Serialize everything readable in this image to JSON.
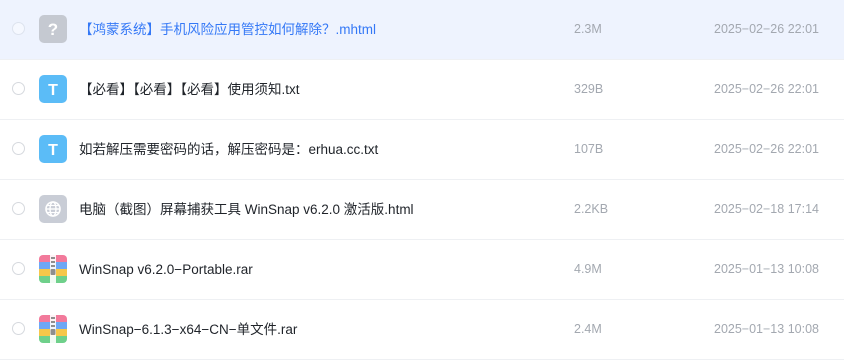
{
  "colors": {
    "selected_row_bg": "#eef3fe",
    "selected_name": "#3478f6",
    "text": "#1f2329",
    "meta_text": "#a3a8b0",
    "txt_icon": "#5bbcf7",
    "unknown_icon": "#c5c9d1",
    "html_icon": "#c9cdd6"
  },
  "files": [
    {
      "name": "【鸿蒙系统】手机风险应用管控如何解除？.mhtml",
      "size": "2.3M",
      "date": "2025−02−26 22:01",
      "icon": "unknown-file-icon",
      "selected": true
    },
    {
      "name": "【必看】【必看】【必看】使用须知.txt",
      "size": "329B",
      "date": "2025−02−26 22:01",
      "icon": "txt-file-icon",
      "icon_letter": "T",
      "selected": false
    },
    {
      "name": "如若解压需要密码的话，解压密码是：erhua.cc.txt",
      "size": "107B",
      "date": "2025−02−26 22:01",
      "icon": "txt-file-icon",
      "icon_letter": "T",
      "selected": false
    },
    {
      "name": "电脑（截图）屏幕捕获工具 WinSnap v6.2.0 激活版.html",
      "size": "2.2KB",
      "date": "2025−02−18 17:14",
      "icon": "html-file-icon",
      "selected": false
    },
    {
      "name": "WinSnap v6.2.0−Portable.rar",
      "size": "4.9M",
      "date": "2025−01−13 10:08",
      "icon": "rar-file-icon",
      "selected": false
    },
    {
      "name": "WinSnap−6.1.3−x64−CN−单文件.rar",
      "size": "2.4M",
      "date": "2025−01−13 10:08",
      "icon": "rar-file-icon",
      "selected": false
    }
  ]
}
